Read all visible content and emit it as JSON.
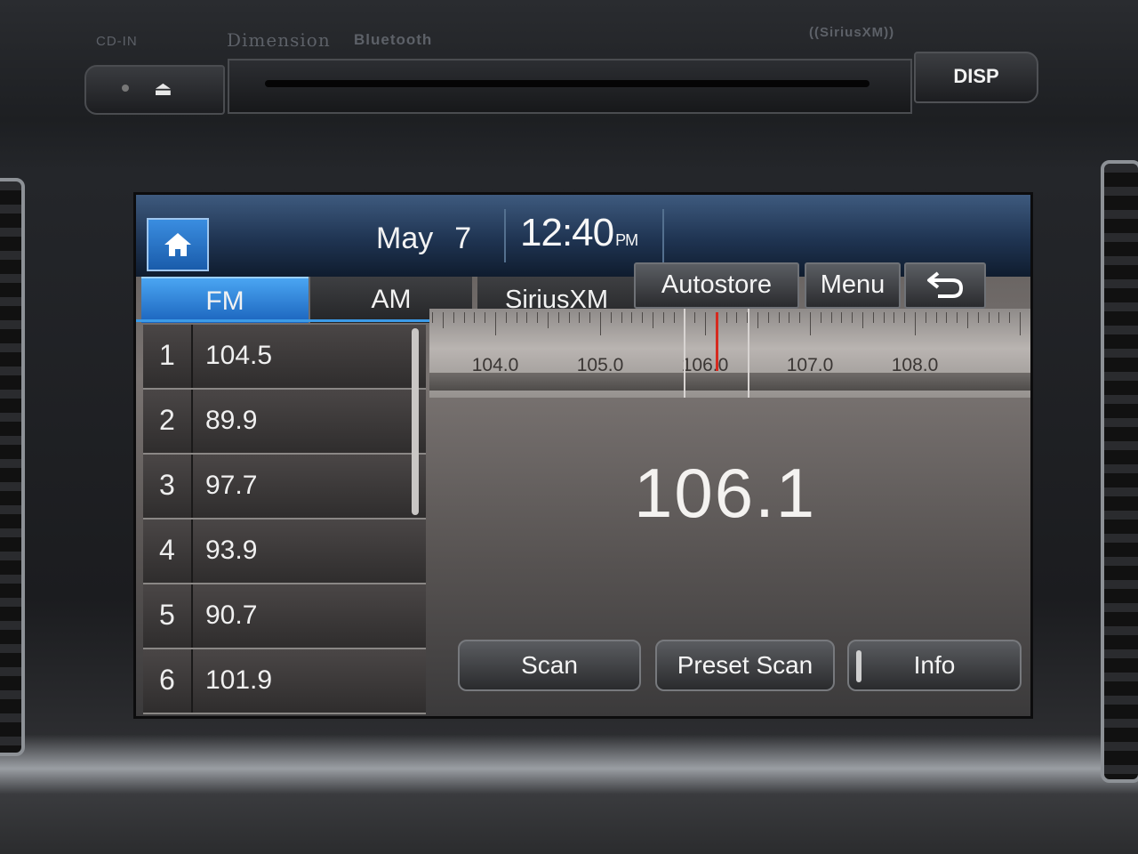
{
  "bezel": {
    "cd_in": "CD-IN",
    "dimension": "Dimension",
    "bluetooth": "Bluetooth",
    "siriusxm_badge": "((SiriusXM))",
    "disp": "DISP"
  },
  "header": {
    "month": "May",
    "day": "7",
    "time": "12:40",
    "ampm": "PM"
  },
  "tabs": [
    {
      "label": "FM",
      "active": true
    },
    {
      "label": "AM",
      "active": false
    },
    {
      "label": "SiriusXM",
      "active": false
    }
  ],
  "actions": {
    "autostore": "Autostore",
    "menu": "Menu"
  },
  "presets": [
    {
      "num": "1",
      "freq": "104.5"
    },
    {
      "num": "2",
      "freq": "89.9"
    },
    {
      "num": "3",
      "freq": "97.7"
    },
    {
      "num": "4",
      "freq": "93.9"
    },
    {
      "num": "5",
      "freq": "90.7"
    },
    {
      "num": "6",
      "freq": "101.9"
    }
  ],
  "dial": {
    "labels": [
      "104.0",
      "105.0",
      "106.0",
      "107.0",
      "108.0"
    ],
    "current": 106.1
  },
  "current_frequency": "106.1",
  "buttons": {
    "scan": "Scan",
    "preset_scan": "Preset Scan",
    "info": "Info"
  },
  "colors": {
    "accent_blue": "#1b64bd",
    "needle_red": "#d62a1f"
  },
  "icons": [
    "home-icon",
    "back-arrow-icon",
    "eject-icon"
  ]
}
